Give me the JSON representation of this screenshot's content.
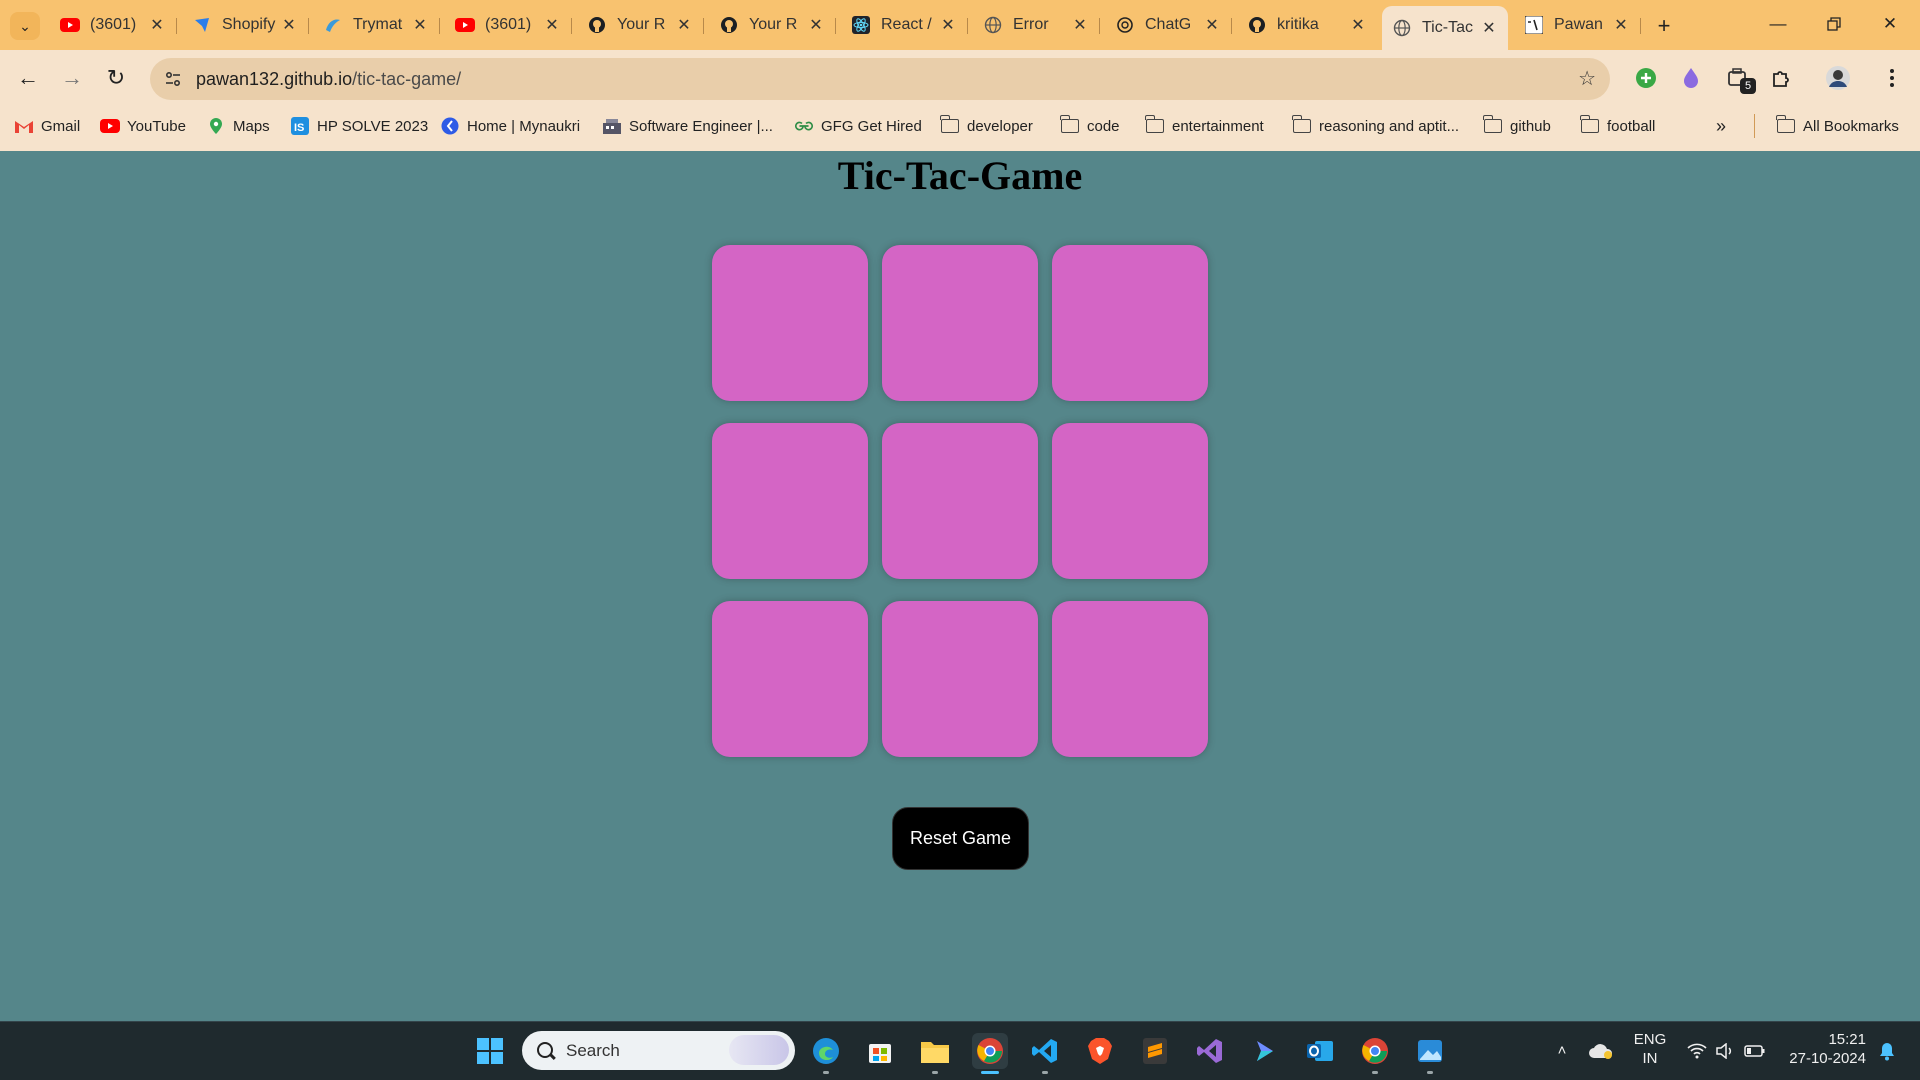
{
  "browser": {
    "tabs": [
      {
        "title": "(3601)",
        "icon": "youtube-icon",
        "active": false
      },
      {
        "title": "Shopify",
        "icon": "shopify-icon",
        "active": false
      },
      {
        "title": "Trymat",
        "icon": "trymata-icon",
        "active": false
      },
      {
        "title": "(3601)",
        "icon": "youtube-icon",
        "active": false
      },
      {
        "title": "Your R",
        "icon": "github-icon",
        "active": false
      },
      {
        "title": "Your R",
        "icon": "github-icon",
        "active": false
      },
      {
        "title": "React /",
        "icon": "react-icon",
        "active": false
      },
      {
        "title": "Error",
        "icon": "globe-icon",
        "active": false
      },
      {
        "title": "ChatG",
        "icon": "chatgpt-icon",
        "active": false
      },
      {
        "title": "kritika",
        "icon": "github-icon",
        "active": false
      },
      {
        "title": "Tic-Tac",
        "icon": "globe-icon",
        "active": true
      },
      {
        "title": "Pawan",
        "icon": "pawan-icon",
        "active": false
      }
    ],
    "address": {
      "host": "pawan132.github.io",
      "path": "/tic-tac-game/"
    },
    "bookmarks": [
      {
        "label": "Gmail",
        "icon": "gmail-icon"
      },
      {
        "label": "YouTube",
        "icon": "youtube-icon"
      },
      {
        "label": "Maps",
        "icon": "maps-icon"
      },
      {
        "label": "HP SOLVE 2023",
        "icon": "hp-solve-icon"
      },
      {
        "label": "Home | Mynaukri",
        "icon": "mynaukri-icon"
      },
      {
        "label": "Software Engineer |...",
        "icon": "software-engineer-icon"
      },
      {
        "label": "GFG Get Hired",
        "icon": "gfg-icon"
      },
      {
        "label": "developer",
        "icon": "folder-icon"
      },
      {
        "label": "code",
        "icon": "folder-icon"
      },
      {
        "label": "entertainment",
        "icon": "folder-icon"
      },
      {
        "label": "reasoning and aptit...",
        "icon": "folder-icon"
      },
      {
        "label": "github",
        "icon": "folder-icon"
      },
      {
        "label": "football",
        "icon": "folder-icon"
      }
    ],
    "all_bookmarks_label": "All Bookmarks",
    "extension_badge": "5"
  },
  "game": {
    "title": "Tic-Tac-Game",
    "cells": [
      "",
      "",
      "",
      "",
      "",
      "",
      "",
      "",
      ""
    ],
    "reset_label": "Reset Game"
  },
  "taskbar": {
    "search_placeholder": "Search",
    "language": "ENG",
    "region": "IN",
    "time": "15:21",
    "date": "27-10-2024"
  },
  "colors": {
    "page_background": "#55868a",
    "cell": "#d465c5",
    "reset_button": "#000000",
    "tabstrip": "#f8c26f",
    "toolbar": "#f6e3cc"
  }
}
